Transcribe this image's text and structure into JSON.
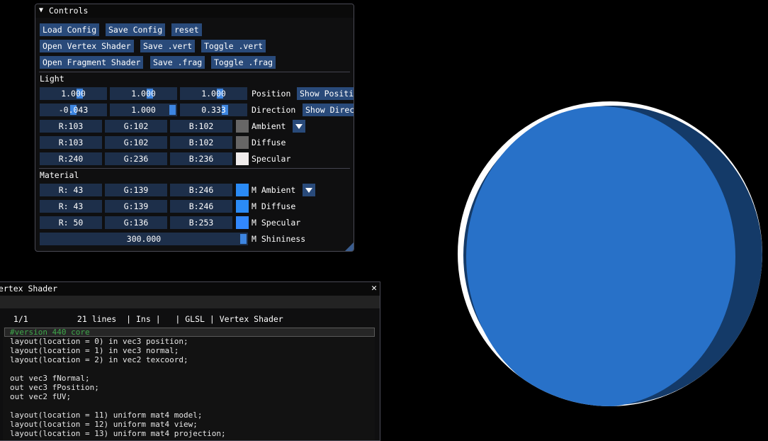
{
  "controls": {
    "title": "Controls",
    "buttons": {
      "load_config": "Load Config",
      "save_config": "Save Config",
      "reset": "reset",
      "open_vertex": "Open Vertex Shader",
      "save_vert": "Save .vert",
      "toggle_vert": "Toggle .vert",
      "open_fragment": "Open Fragment Shader",
      "save_frag": "Save .frag",
      "toggle_frag": "Toggle .frag"
    },
    "light": {
      "header": "Light",
      "position": {
        "values": [
          "1.000",
          "1.000",
          "1.000"
        ],
        "label": "Position",
        "show_label": "Show Positi"
      },
      "direction": {
        "values": [
          "-0.043",
          "1.000",
          "0.333"
        ],
        "label": "Direction",
        "show_label": "Show Direc"
      },
      "ambient": {
        "r": "R:103",
        "g": "G:102",
        "b": "B:102",
        "label": "Ambient",
        "color": "#676666"
      },
      "diffuse": {
        "r": "R:103",
        "g": "G:102",
        "b": "B:102",
        "label": "Diffuse",
        "color": "#676666"
      },
      "specular": {
        "r": "R:240",
        "g": "G:236",
        "b": "B:236",
        "label": "Specular",
        "color": "#f0ecec"
      }
    },
    "material": {
      "header": "Material",
      "ambient": {
        "r": "R: 43",
        "g": "G:139",
        "b": "B:246",
        "label": "M Ambient",
        "color": "#2b8bf6"
      },
      "diffuse": {
        "r": "R: 43",
        "g": "G:139",
        "b": "B:246",
        "label": "M Diffuse",
        "color": "#2b8bf6"
      },
      "specular": {
        "r": "R: 50",
        "g": "G:136",
        "b": "B:253",
        "label": "M Specular",
        "color": "#3288fd"
      },
      "shininess": {
        "value": "300.000",
        "label": "M Shininess"
      }
    }
  },
  "vertex_window": {
    "title": "Vertex Shader",
    "close": "✕",
    "status": " 1/1          21 lines  | Ins |   | GLSL | Vertex Shader",
    "code": [
      "#version 440 core",
      "layout(location = 0) in vec3 position;",
      "layout(location = 1) in vec3 normal;",
      "layout(location = 2) in vec2 texcoord;",
      "",
      "out vec3 fNormal;",
      "out vec3 fPosition;",
      "out vec2 fUV;",
      "",
      "layout(location = 11) uniform mat4 model;",
      "layout(location = 12) uniform mat4 view;",
      "layout(location = 13) uniform mat4 projection;"
    ]
  },
  "scene": {
    "sphere_color": "#2871c8",
    "sphere_shadow": "#143a68",
    "rim_color": "#ffffff"
  }
}
